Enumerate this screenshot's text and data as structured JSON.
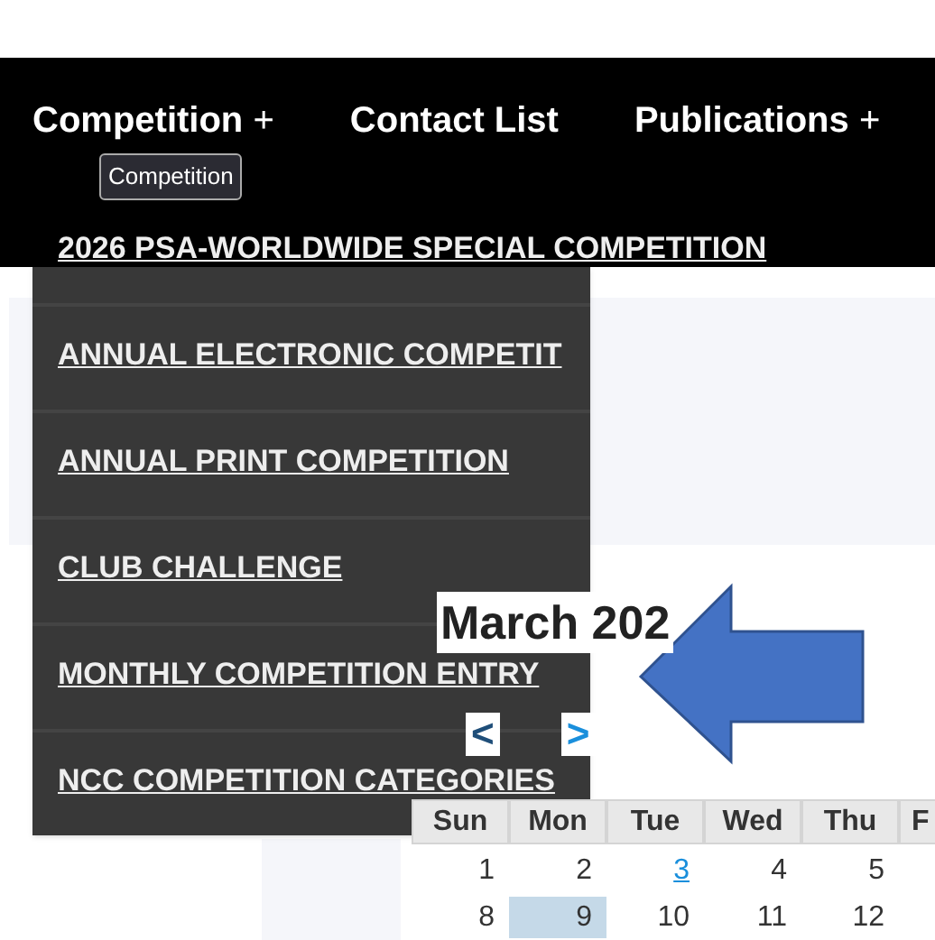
{
  "nav": [
    {
      "label": "Competition",
      "plus": "+"
    },
    {
      "label": "Contact List"
    },
    {
      "label": "Publications",
      "plus": "+"
    }
  ],
  "tooltip": "Competition",
  "dropdown": [
    {
      "label": "2026 PSA-WORLDWIDE SPECIAL COMPETITION"
    },
    {
      "label": "ANNUAL ELECTRONIC COMPETIT"
    },
    {
      "label": "ANNUAL PRINT COMPETITION"
    },
    {
      "label": "CLUB CHALLENGE"
    },
    {
      "label": "MONTHLY COMPETITION ENTRY"
    },
    {
      "label": "NCC COMPETITION CATEGORIES"
    }
  ],
  "calendar": {
    "title": "March 202",
    "prev": "<",
    "next": ">",
    "days": [
      "Sun",
      "Mon",
      "Tue",
      "Wed",
      "Thu",
      "F"
    ],
    "rows": [
      [
        {
          "day": "1",
          "kind": "plain"
        },
        {
          "day": "2",
          "kind": "plain"
        },
        {
          "day": "3",
          "kind": "link"
        },
        {
          "day": "4",
          "kind": "plain"
        },
        {
          "day": "5",
          "kind": "plain"
        }
      ],
      [
        {
          "day": "8",
          "kind": "plain"
        },
        {
          "day": "9",
          "kind": "selected"
        },
        {
          "day": "10",
          "kind": "plain"
        },
        {
          "day": "11",
          "kind": "plain"
        },
        {
          "day": "12",
          "kind": "plain"
        }
      ]
    ]
  }
}
